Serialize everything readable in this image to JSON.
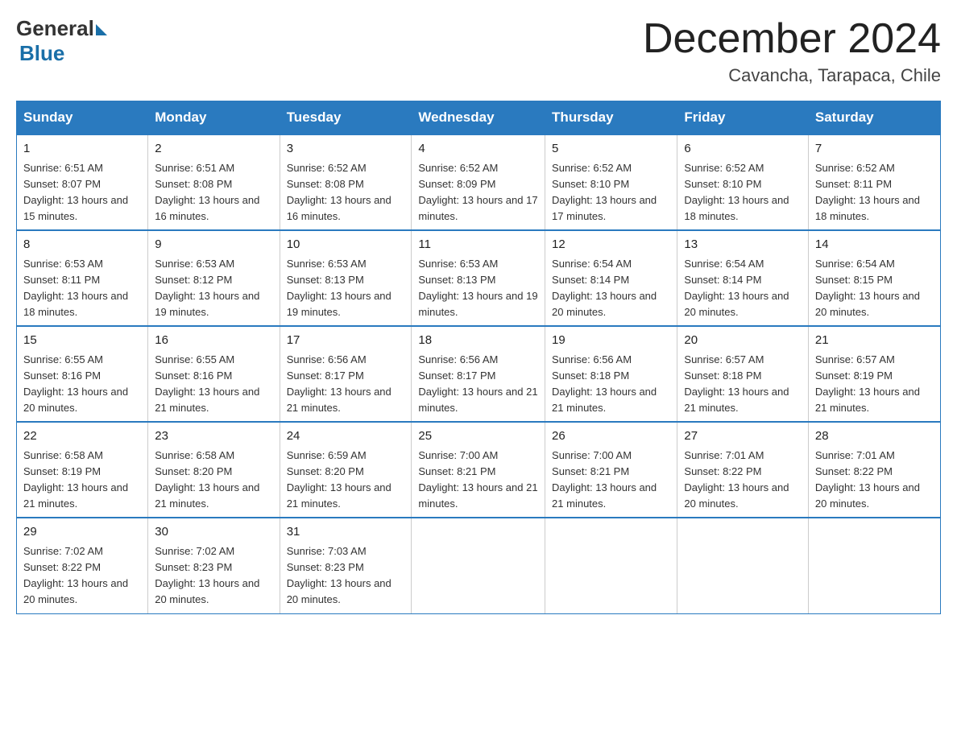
{
  "header": {
    "logo_general": "General",
    "logo_blue": "Blue",
    "month_title": "December 2024",
    "location": "Cavancha, Tarapaca, Chile"
  },
  "days_of_week": [
    "Sunday",
    "Monday",
    "Tuesday",
    "Wednesday",
    "Thursday",
    "Friday",
    "Saturday"
  ],
  "weeks": [
    [
      {
        "day": "1",
        "sunrise": "6:51 AM",
        "sunset": "8:07 PM",
        "daylight": "13 hours and 15 minutes."
      },
      {
        "day": "2",
        "sunrise": "6:51 AM",
        "sunset": "8:08 PM",
        "daylight": "13 hours and 16 minutes."
      },
      {
        "day": "3",
        "sunrise": "6:52 AM",
        "sunset": "8:08 PM",
        "daylight": "13 hours and 16 minutes."
      },
      {
        "day": "4",
        "sunrise": "6:52 AM",
        "sunset": "8:09 PM",
        "daylight": "13 hours and 17 minutes."
      },
      {
        "day": "5",
        "sunrise": "6:52 AM",
        "sunset": "8:10 PM",
        "daylight": "13 hours and 17 minutes."
      },
      {
        "day": "6",
        "sunrise": "6:52 AM",
        "sunset": "8:10 PM",
        "daylight": "13 hours and 18 minutes."
      },
      {
        "day": "7",
        "sunrise": "6:52 AM",
        "sunset": "8:11 PM",
        "daylight": "13 hours and 18 minutes."
      }
    ],
    [
      {
        "day": "8",
        "sunrise": "6:53 AM",
        "sunset": "8:11 PM",
        "daylight": "13 hours and 18 minutes."
      },
      {
        "day": "9",
        "sunrise": "6:53 AM",
        "sunset": "8:12 PM",
        "daylight": "13 hours and 19 minutes."
      },
      {
        "day": "10",
        "sunrise": "6:53 AM",
        "sunset": "8:13 PM",
        "daylight": "13 hours and 19 minutes."
      },
      {
        "day": "11",
        "sunrise": "6:53 AM",
        "sunset": "8:13 PM",
        "daylight": "13 hours and 19 minutes."
      },
      {
        "day": "12",
        "sunrise": "6:54 AM",
        "sunset": "8:14 PM",
        "daylight": "13 hours and 20 minutes."
      },
      {
        "day": "13",
        "sunrise": "6:54 AM",
        "sunset": "8:14 PM",
        "daylight": "13 hours and 20 minutes."
      },
      {
        "day": "14",
        "sunrise": "6:54 AM",
        "sunset": "8:15 PM",
        "daylight": "13 hours and 20 minutes."
      }
    ],
    [
      {
        "day": "15",
        "sunrise": "6:55 AM",
        "sunset": "8:16 PM",
        "daylight": "13 hours and 20 minutes."
      },
      {
        "day": "16",
        "sunrise": "6:55 AM",
        "sunset": "8:16 PM",
        "daylight": "13 hours and 21 minutes."
      },
      {
        "day": "17",
        "sunrise": "6:56 AM",
        "sunset": "8:17 PM",
        "daylight": "13 hours and 21 minutes."
      },
      {
        "day": "18",
        "sunrise": "6:56 AM",
        "sunset": "8:17 PM",
        "daylight": "13 hours and 21 minutes."
      },
      {
        "day": "19",
        "sunrise": "6:56 AM",
        "sunset": "8:18 PM",
        "daylight": "13 hours and 21 minutes."
      },
      {
        "day": "20",
        "sunrise": "6:57 AM",
        "sunset": "8:18 PM",
        "daylight": "13 hours and 21 minutes."
      },
      {
        "day": "21",
        "sunrise": "6:57 AM",
        "sunset": "8:19 PM",
        "daylight": "13 hours and 21 minutes."
      }
    ],
    [
      {
        "day": "22",
        "sunrise": "6:58 AM",
        "sunset": "8:19 PM",
        "daylight": "13 hours and 21 minutes."
      },
      {
        "day": "23",
        "sunrise": "6:58 AM",
        "sunset": "8:20 PM",
        "daylight": "13 hours and 21 minutes."
      },
      {
        "day": "24",
        "sunrise": "6:59 AM",
        "sunset": "8:20 PM",
        "daylight": "13 hours and 21 minutes."
      },
      {
        "day": "25",
        "sunrise": "7:00 AM",
        "sunset": "8:21 PM",
        "daylight": "13 hours and 21 minutes."
      },
      {
        "day": "26",
        "sunrise": "7:00 AM",
        "sunset": "8:21 PM",
        "daylight": "13 hours and 21 minutes."
      },
      {
        "day": "27",
        "sunrise": "7:01 AM",
        "sunset": "8:22 PM",
        "daylight": "13 hours and 20 minutes."
      },
      {
        "day": "28",
        "sunrise": "7:01 AM",
        "sunset": "8:22 PM",
        "daylight": "13 hours and 20 minutes."
      }
    ],
    [
      {
        "day": "29",
        "sunrise": "7:02 AM",
        "sunset": "8:22 PM",
        "daylight": "13 hours and 20 minutes."
      },
      {
        "day": "30",
        "sunrise": "7:02 AM",
        "sunset": "8:23 PM",
        "daylight": "13 hours and 20 minutes."
      },
      {
        "day": "31",
        "sunrise": "7:03 AM",
        "sunset": "8:23 PM",
        "daylight": "13 hours and 20 minutes."
      },
      null,
      null,
      null,
      null
    ]
  ]
}
